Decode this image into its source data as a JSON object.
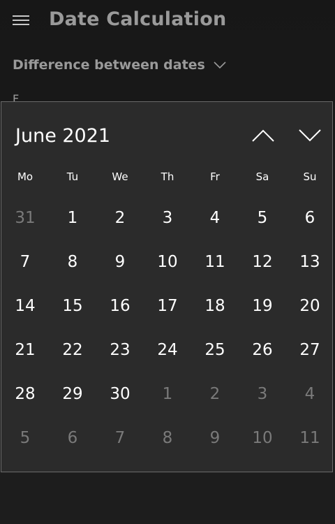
{
  "app": {
    "title": "Date Calculation",
    "menu_icon": "hamburger-icon"
  },
  "mode": {
    "label": "Difference between dates",
    "icon": "chevron-down-icon"
  },
  "peek_label": "F",
  "calendar": {
    "month_label": "June 2021",
    "prev_icon": "chevron-up-icon",
    "next_icon": "chevron-down-icon",
    "weekdays": [
      "Mo",
      "Tu",
      "We",
      "Th",
      "Fr",
      "Sa",
      "Su"
    ],
    "weeks": [
      [
        {
          "d": "31",
          "m": true
        },
        {
          "d": "1"
        },
        {
          "d": "2"
        },
        {
          "d": "3"
        },
        {
          "d": "4"
        },
        {
          "d": "5"
        },
        {
          "d": "6"
        }
      ],
      [
        {
          "d": "7"
        },
        {
          "d": "8"
        },
        {
          "d": "9"
        },
        {
          "d": "10"
        },
        {
          "d": "11"
        },
        {
          "d": "12"
        },
        {
          "d": "13"
        }
      ],
      [
        {
          "d": "14"
        },
        {
          "d": "15"
        },
        {
          "d": "16"
        },
        {
          "d": "17"
        },
        {
          "d": "18"
        },
        {
          "d": "19"
        },
        {
          "d": "20"
        }
      ],
      [
        {
          "d": "21"
        },
        {
          "d": "22"
        },
        {
          "d": "23"
        },
        {
          "d": "24"
        },
        {
          "d": "25"
        },
        {
          "d": "26"
        },
        {
          "d": "27"
        }
      ],
      [
        {
          "d": "28"
        },
        {
          "d": "29"
        },
        {
          "d": "30"
        },
        {
          "d": "1",
          "m": true
        },
        {
          "d": "2",
          "m": true
        },
        {
          "d": "3",
          "m": true
        },
        {
          "d": "4",
          "m": true
        }
      ],
      [
        {
          "d": "5",
          "m": true
        },
        {
          "d": "6",
          "m": true
        },
        {
          "d": "7",
          "m": true
        },
        {
          "d": "8",
          "m": true
        },
        {
          "d": "9",
          "m": true
        },
        {
          "d": "10",
          "m": true
        },
        {
          "d": "11",
          "m": true
        }
      ]
    ]
  }
}
